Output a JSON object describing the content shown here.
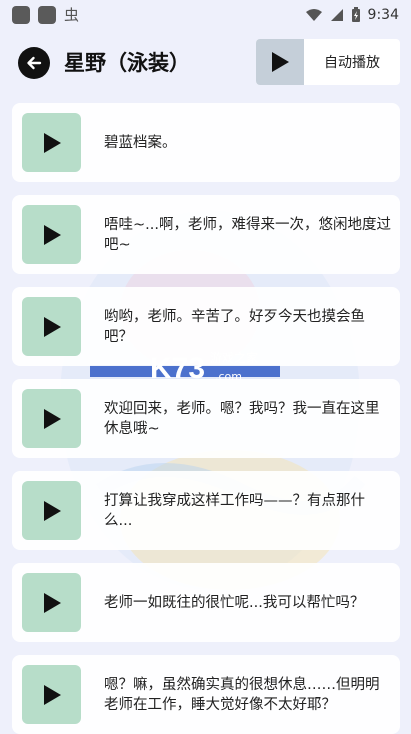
{
  "status_bar": {
    "time": "9:34"
  },
  "header": {
    "title": "星野（泳装）",
    "autoplay_label": "自动播放"
  },
  "voice_lines": [
    {
      "text": "碧蓝档案。"
    },
    {
      "text": "唔哇~...啊，老师，难得来一次，悠闲地度过吧~"
    },
    {
      "text": "哟哟，老师。辛苦了。好歹今天也摸会鱼吧？"
    },
    {
      "text": "欢迎回来，老师。嗯？我吗？我一直在这里休息哦~"
    },
    {
      "text": "打算让我穿成这样工作吗——？有点那什么..."
    },
    {
      "text": "老师一如既往的很忙呢...我可以帮忙吗？"
    },
    {
      "text": "嗯？嘛，虽然确实真的很想休息……但明明老师在工作，睡大觉好像不太好耶？"
    }
  ],
  "watermark": {
    "logo": "K73",
    "site": "游戏之家",
    "domain": ".com"
  },
  "colors": {
    "play_bg": "#b7ddc9",
    "autoplay_play_bg": "#c5cfd9",
    "page_bg": "#eef0fb"
  }
}
